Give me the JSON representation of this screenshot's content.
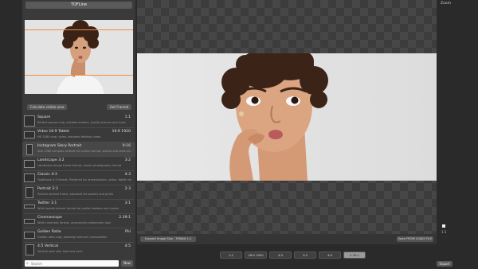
{
  "app": {
    "title": "TOFLine"
  },
  "toolbar": {
    "thumb_left_btn": "Calculate visible area",
    "thumb_right_btn": "Get Framed",
    "support_btn": "Support Image Size - TXWAA 1:1",
    "open_btn": "Open FROM LOAD2 FILE",
    "export_btn": "Export",
    "new_btn": "New",
    "zoom_label": "Zoom",
    "right_ctrl_label": "1:1"
  },
  "search": {
    "placeholder": "Search",
    "value": ""
  },
  "presets": [
    {
      "name": "Square",
      "ratio": "1:1",
      "desc": "Perfect square crop, suitable avatars, profile pictures and icons"
    },
    {
      "name": "Video 16:9 Tablet",
      "ratio": "16:9 1920",
      "desc": "HD 1080 crop, video, standard desktop video"
    },
    {
      "name": "Instagram Story Portrait",
      "ratio": "9:16",
      "desc": "Size 1080 complex vertical full screen format, stories and reels on mobile"
    },
    {
      "name": "Landscape 3:2",
      "ratio": "3:2",
      "desc": "Landscape image frame format, classic photography format"
    },
    {
      "name": "Classic 4:3",
      "ratio": "4:3",
      "desc": "Traditional 4:3 format. Preferred for presentations, slides, tablet views"
    },
    {
      "name": "Portrait 2:3",
      "ratio": "2:3",
      "desc": "Portrait vertical frame, standard for posters and prints"
    },
    {
      "name": "Twitter 3:1",
      "ratio": "3:1",
      "desc": "Wide header banner format for profile headers and covers"
    },
    {
      "name": "Cinemascope",
      "ratio": "2.39:1",
      "desc": "Wide cinematic format, anamorphic widescreen look"
    },
    {
      "name": "Golden Ratio",
      "ratio": "Phi",
      "desc": "Golden ratio crop, pleasing harmonic composition"
    },
    {
      "name": "4:5 Vertical",
      "ratio": "4:5",
      "desc": "Vertical post size, feed and print"
    }
  ],
  "ratio_bar": [
    "1:1",
    "16:9 1920",
    "4:3",
    "3:2",
    "4:5",
    "2.39:1"
  ]
}
